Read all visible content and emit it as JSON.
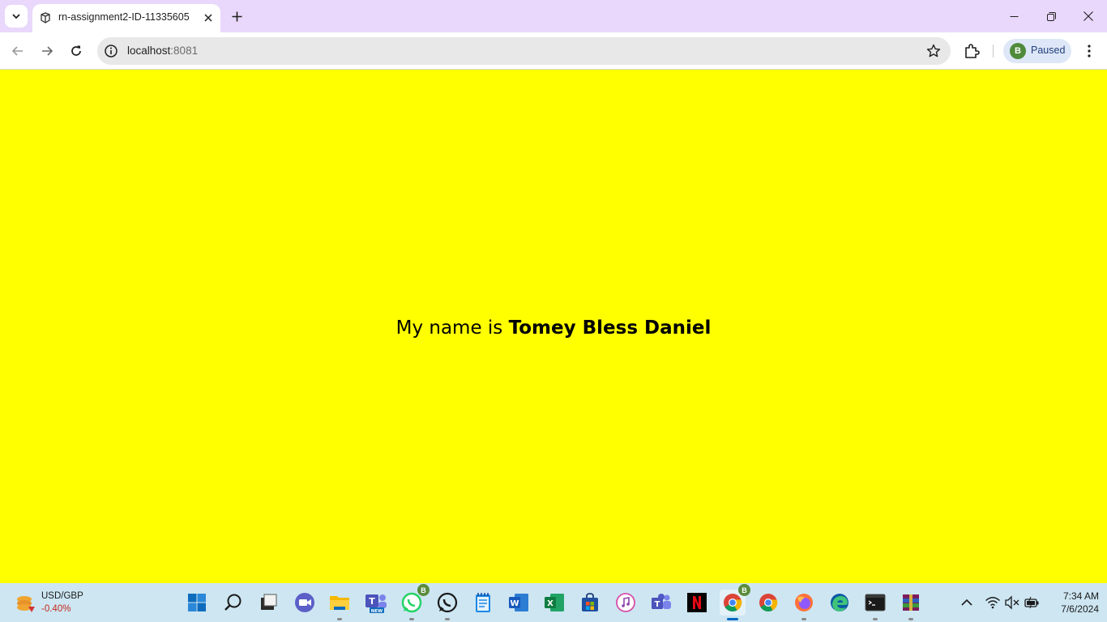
{
  "browser": {
    "tab": {
      "title": "rn-assignment2-ID-11335605"
    },
    "address": {
      "host": "localhost",
      "port": ":8081"
    },
    "profile": {
      "initial": "B",
      "status": "Paused"
    }
  },
  "page": {
    "background": "#ffff00",
    "text_prefix": "My name is ",
    "name": "Tomey Bless Daniel"
  },
  "taskbar": {
    "widget": {
      "title": "USD/GBP",
      "value": "-0.40%"
    },
    "apps": [
      {
        "name": "start",
        "icon": "windows-start-icon"
      },
      {
        "name": "search",
        "icon": "search-icon"
      },
      {
        "name": "task-view",
        "icon": "task-view-icon"
      },
      {
        "name": "meet",
        "icon": "video-call-icon"
      },
      {
        "name": "file-explorer",
        "icon": "folder-icon"
      },
      {
        "name": "teams-new",
        "icon": "teams-icon",
        "label": "NEW"
      },
      {
        "name": "whatsapp-business",
        "icon": "whatsapp-icon",
        "badge": "B"
      },
      {
        "name": "whatsapp",
        "icon": "whatsapp-icon"
      },
      {
        "name": "notepad",
        "icon": "notepad-icon"
      },
      {
        "name": "word",
        "icon": "word-icon",
        "letter": "W"
      },
      {
        "name": "excel",
        "icon": "excel-icon",
        "letter": "X"
      },
      {
        "name": "store",
        "icon": "store-icon"
      },
      {
        "name": "itunes",
        "icon": "music-icon"
      },
      {
        "name": "teams",
        "icon": "teams-icon"
      },
      {
        "name": "netflix",
        "icon": "netflix-icon",
        "letter": "N"
      },
      {
        "name": "chrome-profile",
        "icon": "chrome-icon",
        "badge": "B"
      },
      {
        "name": "chrome",
        "icon": "chrome-icon"
      },
      {
        "name": "firefox",
        "icon": "firefox-icon"
      },
      {
        "name": "edge",
        "icon": "edge-icon"
      },
      {
        "name": "terminal",
        "icon": "terminal-icon"
      },
      {
        "name": "winrar",
        "icon": "winrar-icon"
      }
    ],
    "clock": {
      "time": "7:34 AM",
      "date": "7/6/2024"
    }
  }
}
